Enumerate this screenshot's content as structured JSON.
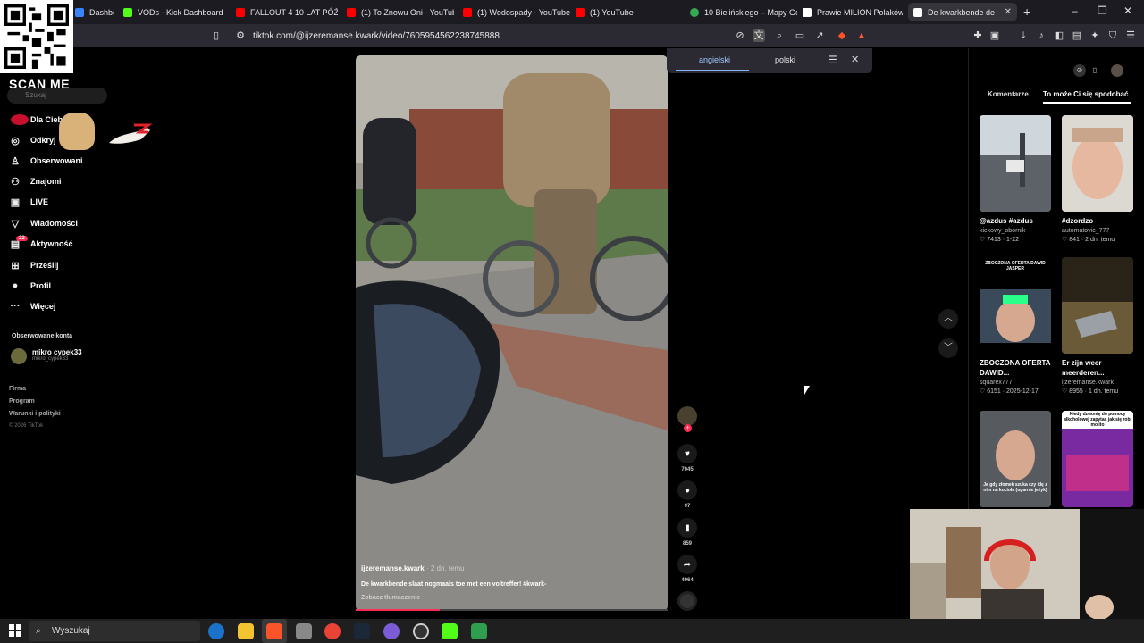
{
  "browser": {
    "tabs": [
      {
        "label": "Dashbo",
        "color": "#3b82f6"
      },
      {
        "label": "VODs - Kick Dashboard",
        "color": "#53fc18"
      },
      {
        "label": "FALLOUT 4 10 LAT PÓŹNIE",
        "color": "#ff0000"
      },
      {
        "label": "(1) To Znowu Oni - YouTub",
        "color": "#ff0000"
      },
      {
        "label": "(1) Wodospady - YouTube",
        "color": "#ff0000"
      },
      {
        "label": "(1) YouTube",
        "color": "#ff0000"
      },
      {
        "label": "10 Bielińskiego – Mapy Go",
        "color": "#34a853"
      },
      {
        "label": "Prawie MILION Polaków b",
        "color": "#ffffff"
      },
      {
        "label": "De kwarkbende de",
        "color": "#ffffff"
      }
    ],
    "url": "tiktok.com/@ijzeremanse.kwark/video/7605954562238745888"
  },
  "overlay": {
    "scan_me": "SCAN ME"
  },
  "sidebar": {
    "search_placeholder": "Szukaj",
    "items": [
      {
        "label": "Dla Ciebie",
        "icon": "home-icon"
      },
      {
        "label": "Odkryj",
        "icon": "compass-icon"
      },
      {
        "label": "Obserwowani",
        "icon": "user-icon"
      },
      {
        "label": "Znajomi",
        "icon": "friends-icon"
      },
      {
        "label": "LIVE",
        "icon": "live-icon"
      },
      {
        "label": "Wiadomości",
        "icon": "message-icon"
      },
      {
        "label": "Aktywność",
        "icon": "inbox-icon",
        "badge": "22"
      },
      {
        "label": "Prześlij",
        "icon": "upload-icon"
      },
      {
        "label": "Profil",
        "icon": "profile-icon"
      },
      {
        "label": "Więcej",
        "icon": "more-icon"
      }
    ],
    "followed_heading": "Obserwowane konta",
    "followed": [
      {
        "name": "mikro cypek33",
        "handle": "mikro_cypek33"
      }
    ],
    "footer": [
      "Firma",
      "Program",
      "Warunki i polityki"
    ],
    "copyright": "© 2026 TikTok"
  },
  "video": {
    "author": "ijzeremanse.kwark",
    "time": " · 2 dn. temu",
    "caption": "De kwarkbende slaat nogmaals toe met een voltreffer! #kwark-",
    "translate_link": "Zobacz tłumaczenie",
    "progress": 0.27
  },
  "actions": {
    "likes": "7045",
    "comments": "97",
    "saves": "859",
    "shares": "4964"
  },
  "translate_popup": {
    "source": "angielski",
    "target": "polski"
  },
  "right_panel": {
    "tab_comments": "Komentarze",
    "tab_recommended": "To może Ci się spodobać",
    "cards": [
      {
        "title": "@azdus #azdus",
        "user": "kickowy_obornik",
        "stats": "♡ 7413 · 1-22",
        "thumb_color": "#8e9aa6"
      },
      {
        "title": "#dzordzo",
        "user": "automatovic_777",
        "stats": "♡ 841 · 2 dn. temu",
        "thumb_color": "#c7b7a8"
      },
      {
        "title": "ZBOCZONA OFERTA DAWID...",
        "user": "squarex777",
        "stats": "♡ 6151 · 2025-12-17",
        "thumb_color": "#3a4a5a",
        "thumb_text": "ZBOCZONA OFERTA DAWID JASPER"
      },
      {
        "title": "Er zijn weer meerderen...",
        "user": "ijzeremanse.kwark",
        "stats": "♡ 8955 · 1 dn. temu",
        "thumb_color": "#2a2418"
      },
      {
        "title": "",
        "user": "",
        "stats": "",
        "thumb_color": "#6b6f75",
        "thumb_text": "Ja gdy złomek szuka czy idę z nim na kocioła (ogarnie jeżyk)"
      },
      {
        "title": "",
        "user": "",
        "stats": "",
        "thumb_color": "#5a2a6a",
        "thumb_text": "Kiedy dzwonię do pomocy alkoholowej zapytać jak się robi mojito"
      }
    ]
  },
  "taskbar": {
    "search_label": "Wyszukaj"
  }
}
